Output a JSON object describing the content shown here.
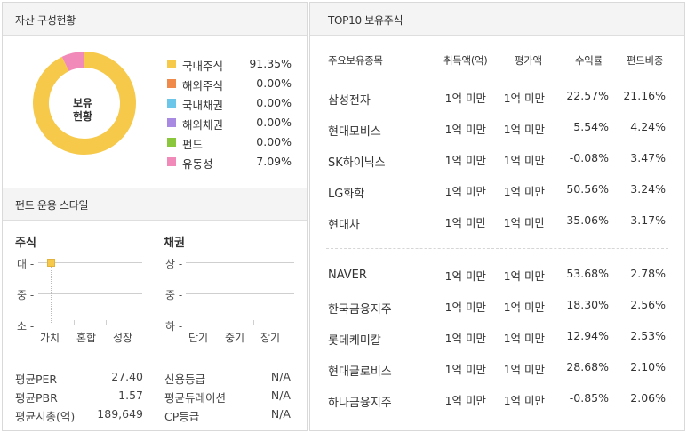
{
  "asset": {
    "title": "자산 구성현황",
    "center_label_1": "보유",
    "center_label_2": "현황",
    "items": [
      {
        "name": "국내주식",
        "pct": "91.35%",
        "color": "#f6c94a",
        "value": 91.35
      },
      {
        "name": "해외주식",
        "pct": "0.00%",
        "color": "#f08a4b",
        "value": 0
      },
      {
        "name": "국내채권",
        "pct": "0.00%",
        "color": "#6cc6ea",
        "value": 0
      },
      {
        "name": "해외채권",
        "pct": "0.00%",
        "color": "#a98ae2",
        "value": 0
      },
      {
        "name": "펀드",
        "pct": "0.00%",
        "color": "#8ac73d",
        "value": 0
      },
      {
        "name": "유동성",
        "pct": "7.09%",
        "color": "#f28ab9",
        "value": 7.09
      }
    ]
  },
  "style": {
    "title": "펀드 운용 스타일",
    "stock": {
      "title": "주식",
      "y_labels": [
        "대 -",
        "중 -",
        "소 -"
      ],
      "x_labels": [
        "가치",
        "혼합",
        "성장"
      ],
      "selected_size": "대",
      "selected_style": "가치"
    },
    "bond": {
      "title": "채권",
      "y_labels": [
        "상 -",
        "중 -",
        "하 -"
      ],
      "x_labels": [
        "단기",
        "중기",
        "장기"
      ]
    },
    "stock_stats": [
      {
        "k": "평균PER",
        "v": "27.40"
      },
      {
        "k": "평균PBR",
        "v": "1.57"
      },
      {
        "k": "평균시총(억)",
        "v": "189,649"
      }
    ],
    "bond_stats": [
      {
        "k": "신용등급",
        "v": "N/A"
      },
      {
        "k": "평균듀레이션",
        "v": "N/A"
      },
      {
        "k": "CP등급",
        "v": "N/A"
      }
    ]
  },
  "top10": {
    "title": "TOP10 보유주식",
    "headers": [
      "주요보유종목",
      "취득액(억)",
      "평가액",
      "수익률",
      "편드비중"
    ],
    "rows": [
      {
        "name": "삼성전자",
        "buy": "1억 미만",
        "eval": "1억 미만",
        "ret": "22.57%",
        "weight": "21.16%"
      },
      {
        "name": "현대모비스",
        "buy": "1억 미만",
        "eval": "1억 미만",
        "ret": "5.54%",
        "weight": "4.24%"
      },
      {
        "name": "SK하이닉스",
        "buy": "1억 미만",
        "eval": "1억 미만",
        "ret": "-0.08%",
        "weight": "3.47%"
      },
      {
        "name": "LG화학",
        "buy": "1억 미만",
        "eval": "1억 미만",
        "ret": "50.56%",
        "weight": "3.24%"
      },
      {
        "name": "현대차",
        "buy": "1억 미만",
        "eval": "1억 미만",
        "ret": "35.06%",
        "weight": "3.17%"
      },
      {
        "name": "NAVER",
        "buy": "1억 미만",
        "eval": "1억 미만",
        "ret": "53.68%",
        "weight": "2.78%"
      },
      {
        "name": "한국금융지주",
        "buy": "1억 미만",
        "eval": "1억 미만",
        "ret": "18.30%",
        "weight": "2.56%"
      },
      {
        "name": "롯데케미칼",
        "buy": "1억 미만",
        "eval": "1억 미만",
        "ret": "12.94%",
        "weight": "2.53%"
      },
      {
        "name": "현대글로비스",
        "buy": "1억 미만",
        "eval": "1억 미만",
        "ret": "28.68%",
        "weight": "2.10%"
      },
      {
        "name": "하나금융지주",
        "buy": "1억 미만",
        "eval": "1억 미만",
        "ret": "-0.85%",
        "weight": "2.06%"
      }
    ]
  }
}
